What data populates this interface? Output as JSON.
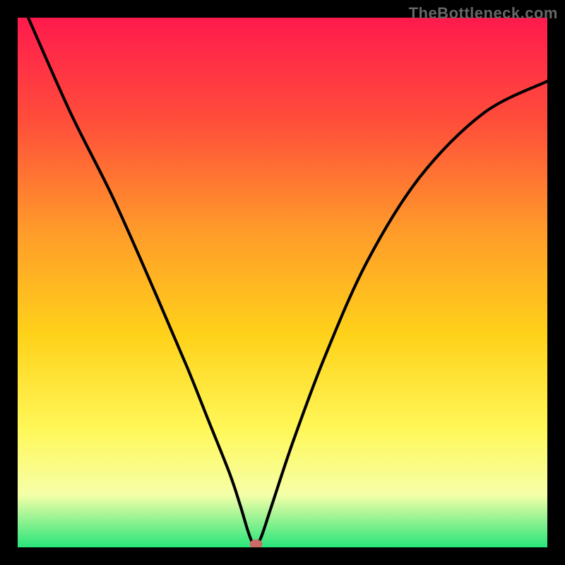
{
  "watermark": "TheBottleneck.com",
  "chart_data": {
    "type": "line",
    "title": "",
    "xlabel": "",
    "ylabel": "",
    "xlim": [
      0,
      100
    ],
    "ylim": [
      0,
      100
    ],
    "series": [
      {
        "name": "curve",
        "x": [
          2,
          10,
          18,
          26,
          32,
          36,
          40,
          42,
          43.5,
          44.5,
          45,
          46,
          48,
          52,
          58,
          66,
          76,
          88,
          100
        ],
        "y": [
          100,
          82,
          66,
          48,
          34,
          24,
          14,
          8,
          3,
          0.5,
          0.5,
          2,
          8,
          20,
          36,
          54,
          70,
          82,
          88
        ]
      }
    ],
    "marker": {
      "x": 45,
      "y": 0.6
    },
    "gradient_stops": [
      {
        "offset": 0,
        "color": "#ff1a4d"
      },
      {
        "offset": 20,
        "color": "#ff4f3a"
      },
      {
        "offset": 40,
        "color": "#ff9a2a"
      },
      {
        "offset": 60,
        "color": "#ffd21a"
      },
      {
        "offset": 78,
        "color": "#fff85a"
      },
      {
        "offset": 90,
        "color": "#f6ffa8"
      },
      {
        "offset": 100,
        "color": "#28e57a"
      }
    ]
  }
}
